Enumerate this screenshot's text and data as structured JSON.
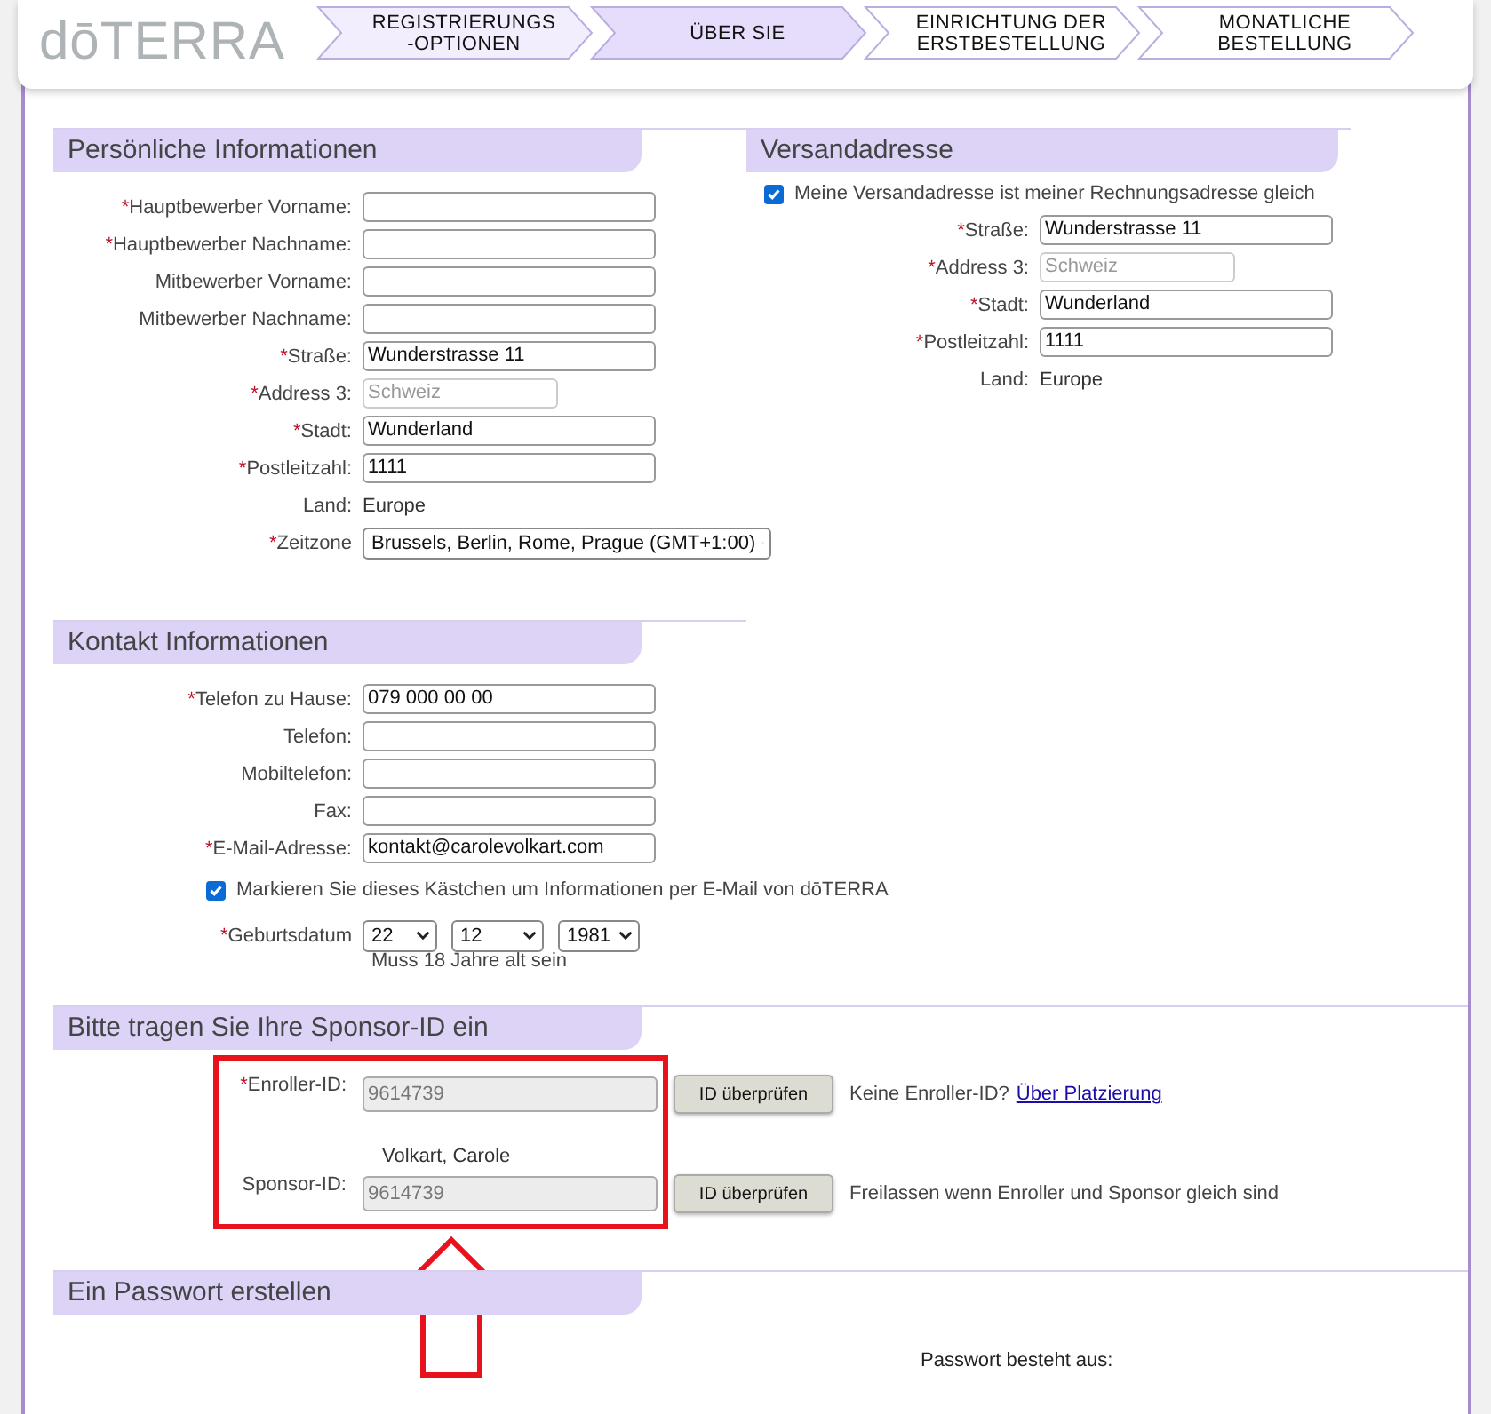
{
  "logo": "dōTERRA",
  "steps": [
    {
      "label": "REGISTRIERUNGS\n-OPTIONEN",
      "selected": false,
      "completed": true
    },
    {
      "label": "ÜBER SIE",
      "selected": true,
      "completed": false
    },
    {
      "label": "EINRICHTUNG DER\nERSTBESTELLUNG",
      "selected": false,
      "completed": false
    },
    {
      "label": "MONATLICHE\nBESTELLUNG",
      "selected": false,
      "completed": false
    }
  ],
  "personal": {
    "title": "Persönliche Informationen",
    "fields": [
      {
        "mark": "*",
        "label": "Hauptbewerber Vorname:",
        "kind": "text"
      },
      {
        "mark": "*",
        "label": "Hauptbewerber Nachname:",
        "kind": "text"
      },
      {
        "label": "Mitbewerber Vorname:",
        "kind": "text"
      },
      {
        "label": "Mitbewerber Nachname:",
        "kind": "text"
      },
      {
        "mark": "*",
        "label": "Straße:",
        "kind": "text",
        "value": "Wunderstrasse 11"
      },
      {
        "mark": "*",
        "label": "Address 3:",
        "kind": "disabled",
        "value": "Schweiz"
      },
      {
        "mark": "*",
        "label": "Stadt:",
        "kind": "text",
        "value": "Wunderland"
      },
      {
        "mark": "*",
        "label": "Postleitzahl:",
        "kind": "text",
        "value": "1111"
      },
      {
        "label": "Land:",
        "kind": "static",
        "value": "Europe"
      },
      {
        "mark": "*",
        "label": "Zeitzone",
        "kind": "select",
        "value": "Brussels, Berlin, Rome, Prague (GMT+1:00)"
      }
    ]
  },
  "shipping": {
    "title": "Versandadresse",
    "same_address": {
      "label": "Meine Versandadresse ist meiner Rechnungsadresse gleich",
      "checked": true
    },
    "fields": [
      {
        "mark": "*",
        "label": "Straße:",
        "kind": "text",
        "value": "Wunderstrasse 11"
      },
      {
        "mark": "*",
        "label": "Address 3:",
        "kind": "disabled",
        "value": "Schweiz"
      },
      {
        "mark": "*",
        "label": "Stadt:",
        "kind": "text",
        "value": "Wunderland"
      },
      {
        "mark": "*",
        "label": "Postleitzahl:",
        "kind": "text",
        "value": "1111"
      },
      {
        "label": "Land:",
        "kind": "static",
        "value": "Europe"
      }
    ]
  },
  "contact": {
    "title": "Kontakt Informationen",
    "fields": [
      {
        "mark": "*",
        "label": "Telefon zu Hause:",
        "kind": "text",
        "value": "079 000 00 00"
      },
      {
        "label": "Telefon:",
        "kind": "text"
      },
      {
        "label": "Mobiltelefon:",
        "kind": "text"
      },
      {
        "label": "Fax:",
        "kind": "text"
      },
      {
        "mark": "*",
        "label": "E-Mail-Adresse:",
        "kind": "text",
        "value": "kontakt@carolevolkart.com"
      }
    ],
    "newsletter": {
      "label": "Markieren Sie dieses Kästchen um Informationen per E-Mail von dōTERRA",
      "checked": true
    },
    "birthdate": {
      "mark": "*",
      "label": "Geburtsdatum",
      "day": "22",
      "month": "12",
      "year": "1981",
      "hint": "Muss 18 Jahre alt sein"
    }
  },
  "sponsor": {
    "title": "Bitte tragen Sie Ihre Sponsor-ID ein",
    "enroller": {
      "mark": "*",
      "label": "Enroller-ID:",
      "value": "9614739",
      "button": "ID überprüfen",
      "note": "Keine Enroller-ID?",
      "link": "Über Platzierung"
    },
    "sponsor_name": "Volkart, Carole",
    "sponsor_id": {
      "label": "Sponsor-ID:",
      "value": "9614739",
      "button": "ID überprüfen",
      "note": "Freilassen wenn Enroller und Sponsor gleich sind"
    }
  },
  "password": {
    "title": "Ein Passwort erstellen",
    "hint": "Passwort besteht aus:"
  }
}
